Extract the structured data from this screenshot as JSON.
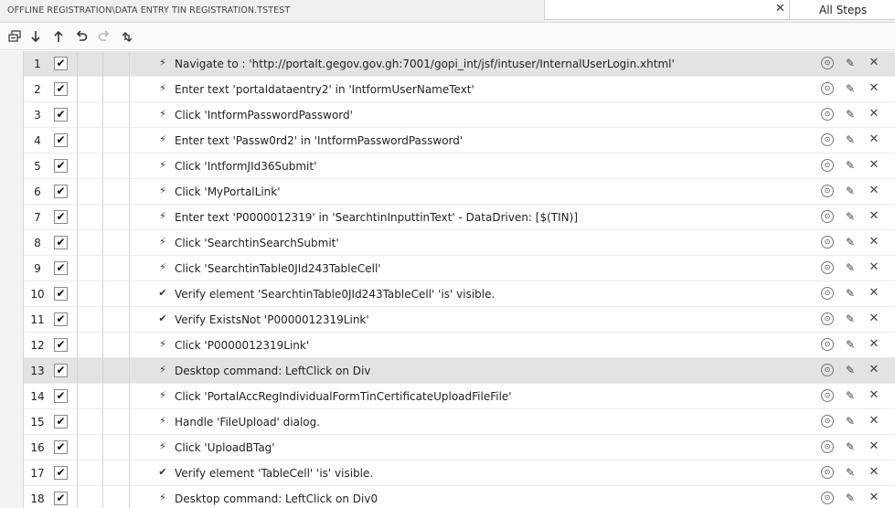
{
  "header": {
    "title": "OFFLINE REGISTRATION\\DATA ENTRY TIN REGISTRATION.TSTEST",
    "search_value": "",
    "search_clear": "✕",
    "filter_label": "All Steps"
  },
  "toolbar": {
    "icons": [
      "collapse-all-icon",
      "move-down-icon",
      "move-up-icon",
      "undo-icon",
      "redo-icon",
      "reorder-icon"
    ]
  },
  "icons": {
    "action": "⚡",
    "verify": "✔",
    "info": "⊙",
    "edit": "✎",
    "delete": "✕"
  },
  "steps": [
    {
      "num": "1",
      "checked": true,
      "type": "action",
      "text": "Navigate to : 'http://portalt.gegov.gov.gh:7001/gopi_int/jsf/intuser/InternalUserLogin.xhtml'",
      "selected": true
    },
    {
      "num": "2",
      "checked": true,
      "type": "action",
      "text": "Enter text 'portaldataentry2' in 'IntformUserNameText'",
      "selected": false
    },
    {
      "num": "3",
      "checked": true,
      "type": "action",
      "text": "Click 'IntformPasswordPassword'",
      "selected": false
    },
    {
      "num": "4",
      "checked": true,
      "type": "action",
      "text": "Enter text 'Passw0rd2' in 'IntformPasswordPassword'",
      "selected": false
    },
    {
      "num": "5",
      "checked": true,
      "type": "action",
      "text": "Click 'IntformJId36Submit'",
      "selected": false
    },
    {
      "num": "6",
      "checked": true,
      "type": "action",
      "text": "Click 'MyPortalLink'",
      "selected": false
    },
    {
      "num": "7",
      "checked": true,
      "type": "action",
      "text": "Enter text 'P0000012319' in 'SearchtinInputtinText' - DataDriven: [$(TIN)]",
      "selected": false
    },
    {
      "num": "8",
      "checked": true,
      "type": "action",
      "text": "Click 'SearchtinSearchSubmit'",
      "selected": false
    },
    {
      "num": "9",
      "checked": true,
      "type": "action",
      "text": "Click 'SearchtinTable0JId243TableCell'",
      "selected": false
    },
    {
      "num": "10",
      "checked": true,
      "type": "verify",
      "text": "Verify element 'SearchtinTable0JId243TableCell' 'is' visible.",
      "selected": false
    },
    {
      "num": "11",
      "checked": true,
      "type": "verify",
      "text": "Verify ExistsNot 'P0000012319Link'",
      "selected": false
    },
    {
      "num": "12",
      "checked": true,
      "type": "action",
      "text": "Click 'P0000012319Link'",
      "selected": false
    },
    {
      "num": "13",
      "checked": true,
      "type": "action",
      "text": "Desktop command: LeftClick on Div",
      "selected": true
    },
    {
      "num": "14",
      "checked": true,
      "type": "action",
      "text": "Click 'PortalAccRegIndividualFormTinCertificateUploadFileFile'",
      "selected": false
    },
    {
      "num": "15",
      "checked": true,
      "type": "action",
      "text": "Handle 'FileUpload' dialog.",
      "selected": false
    },
    {
      "num": "16",
      "checked": true,
      "type": "action",
      "text": "Click 'UploadBTag'",
      "selected": false
    },
    {
      "num": "17",
      "checked": true,
      "type": "verify",
      "text": "Verify element 'TableCell' 'is' visible.",
      "selected": false
    },
    {
      "num": "18",
      "checked": true,
      "type": "action",
      "text": "Desktop command: LeftClick on Div0",
      "selected": false
    }
  ]
}
